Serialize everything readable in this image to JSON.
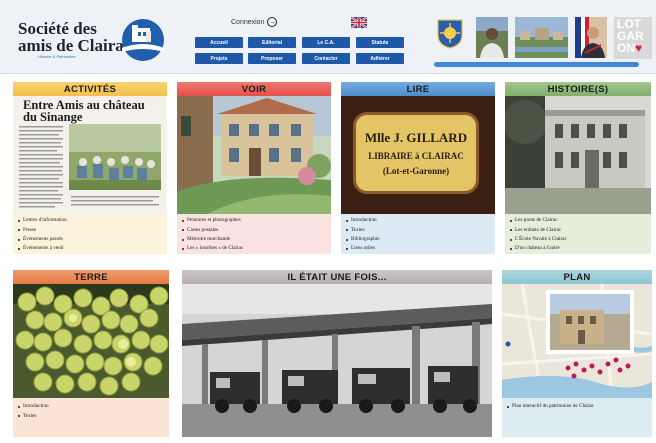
{
  "header": {
    "logo_line1": "Société des",
    "logo_line2": "amis de Clairac",
    "logo_tagline": "Histoire & Patrimoine",
    "connexion_label": "Connexion",
    "connexion_icon": "arrow-right-circle-icon",
    "flag_icon": "uk-flag-icon",
    "nav_row1": [
      "Accueil",
      "Editorial",
      "Le C.A.",
      "Statuts"
    ],
    "nav_row2": [
      "Projets",
      "Proposer",
      "Contacter",
      "Adhérer"
    ],
    "lotgaron": [
      "LOT",
      "GAR",
      "ON"
    ],
    "nav_color": "#1e58a8",
    "bar_color": "#3f87d8"
  },
  "cards": {
    "activites": {
      "title": "ACTIVITÉS",
      "newspaper_title_1": "Entre Amis au château",
      "newspaper_title_2": "du Sinange",
      "items": [
        "Lettres d'information",
        "Presse",
        "Événements passés",
        "Événements à venir"
      ],
      "color": "#f2c24a"
    },
    "voir": {
      "title": "VOIR",
      "items": [
        "Peintures et photographes",
        "Cartes postales",
        "Mémoire marchande",
        "Les « insolites » de Clairac"
      ],
      "color": "#e45048"
    },
    "lire": {
      "title": "LIRE",
      "sign_line1": "Mlle J. GILLARD",
      "sign_line2": "LIBRAIRE à CLAIRAC",
      "sign_line3": "(Lot-et-Garonne)",
      "items": [
        "Introduction",
        "Textes",
        "Bibliographie",
        "Liens utiles"
      ],
      "color": "#4a8fd0"
    },
    "histoire": {
      "title": "HISTOIRE(S)",
      "items": [
        "Les ponts de Clairac",
        "Les enfants de Clairac",
        "L'École Navale à Clairac",
        "D'un château à l'autre"
      ],
      "color": "#7faf6a"
    },
    "terre": {
      "title": "TERRE",
      "items": [
        "Introduction",
        "Textes"
      ],
      "color": "#e57a45"
    },
    "il_etait": {
      "title": "IL ÉTAIT UNE FOIS...",
      "color": "#b8aeb2"
    },
    "plan": {
      "title": "PLAN",
      "items": [
        "Plan interactif du patrimoine de Clairac"
      ],
      "color": "#8fc6cf"
    }
  }
}
